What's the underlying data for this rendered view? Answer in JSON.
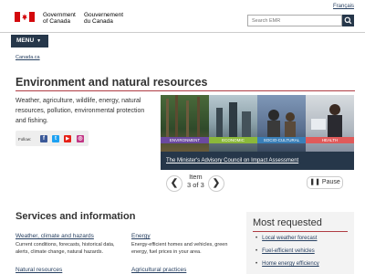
{
  "header": {
    "signature_en": [
      "Government",
      "of Canada"
    ],
    "signature_fr": [
      "Gouvernement",
      "du Canada"
    ],
    "language_link": "Français",
    "search_placeholder": "Search EMR"
  },
  "menu": {
    "label": "MENU"
  },
  "breadcrumb": {
    "items": [
      "Canada.ca"
    ]
  },
  "page": {
    "title": "Environment and natural resources",
    "intro": "Weather, agriculture, wildlife, energy, natural resources, pollution, environmental protection and fishing.",
    "follow_label": "Follow:",
    "social": [
      {
        "name": "facebook",
        "glyph": "f",
        "color": "#3b5998"
      },
      {
        "name": "twitter",
        "glyph": "t",
        "color": "#1da1f2"
      },
      {
        "name": "youtube",
        "glyph": "▶",
        "color": "#e62117"
      },
      {
        "name": "instagram",
        "glyph": "◎",
        "color": "#c13584"
      }
    ]
  },
  "carousel": {
    "tags": [
      "ENVIRONMENT",
      "ECONOMIC",
      "SOCIO-CULTURAL",
      "HEALTH"
    ],
    "tag_colors": [
      "#6b4aa0",
      "#8bb83a",
      "#3a7fb8",
      "#e05a5a"
    ],
    "caption": "The Minister's Advisory Council on Impact Assessment",
    "item_label": "Item",
    "item_position": "3 of 3",
    "prev_symbol": "❮",
    "next_symbol": "❯",
    "pause_label": "❚❚ Pause"
  },
  "services": {
    "heading": "Services and information",
    "items": [
      {
        "title": "Weather, climate and hazards",
        "desc": [
          "Current conditions, forecasts, historical data,",
          "alerts, climate change, natural hazards."
        ]
      },
      {
        "title": "Energy",
        "desc": [
          "Energy-efficient homes and vehicles, green",
          "energy, fuel prices in your area."
        ]
      },
      {
        "title": "Natural resources",
        "desc": []
      },
      {
        "title": "Agricultural practices",
        "desc": []
      }
    ]
  },
  "most_requested": {
    "heading": "Most requested",
    "items": [
      "Local weather forecast",
      "Fuel-efficient vehicles",
      "Home energy efficiency"
    ]
  }
}
